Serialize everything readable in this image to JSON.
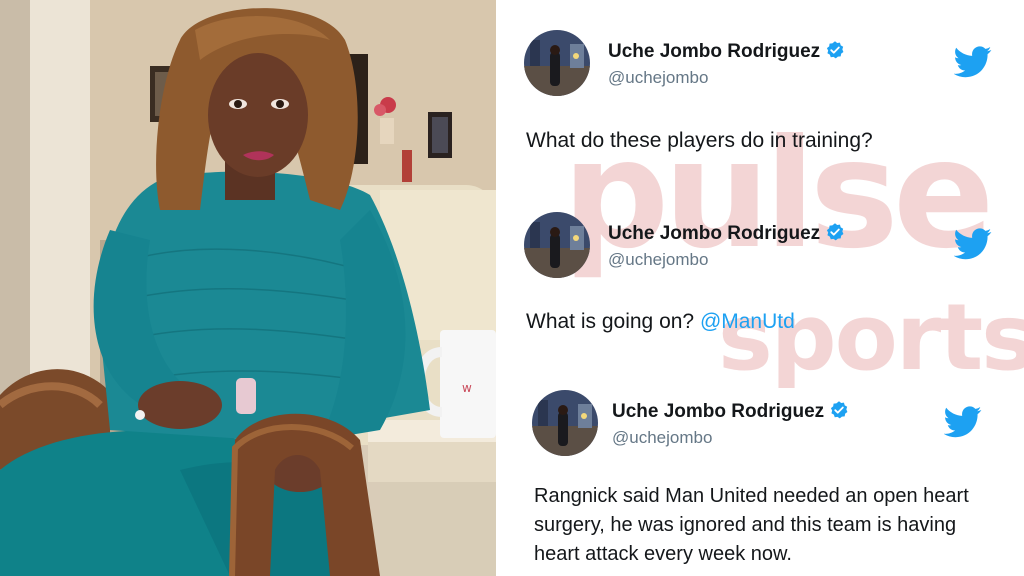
{
  "colors": {
    "verified_blue": "#1da1f2",
    "mention_blue": "#1da1f2",
    "watermark": "#e6a4a4",
    "text_primary": "#14171a",
    "text_secondary": "#657786"
  },
  "icons": {
    "verified": "verified-badge-icon",
    "brand": "twitter-bird-icon"
  },
  "watermark": {
    "line1": "pulse",
    "line2": "sports"
  },
  "tweets": [
    {
      "display_name": "Uche Jombo Rodriguez",
      "handle": "@uchejombo",
      "text": "What do these players do in training?",
      "mention": ""
    },
    {
      "display_name": "Uche Jombo Rodriguez",
      "handle": "@uchejombo",
      "text": "What is going on? ",
      "mention": "@ManUtd"
    },
    {
      "display_name": "Uche Jombo Rodriguez",
      "handle": "@uchejombo",
      "text": "Rangnick said Man United needed an open heart surgery, he was ignored and this team is having heart attack every week now.",
      "mention": ""
    }
  ]
}
